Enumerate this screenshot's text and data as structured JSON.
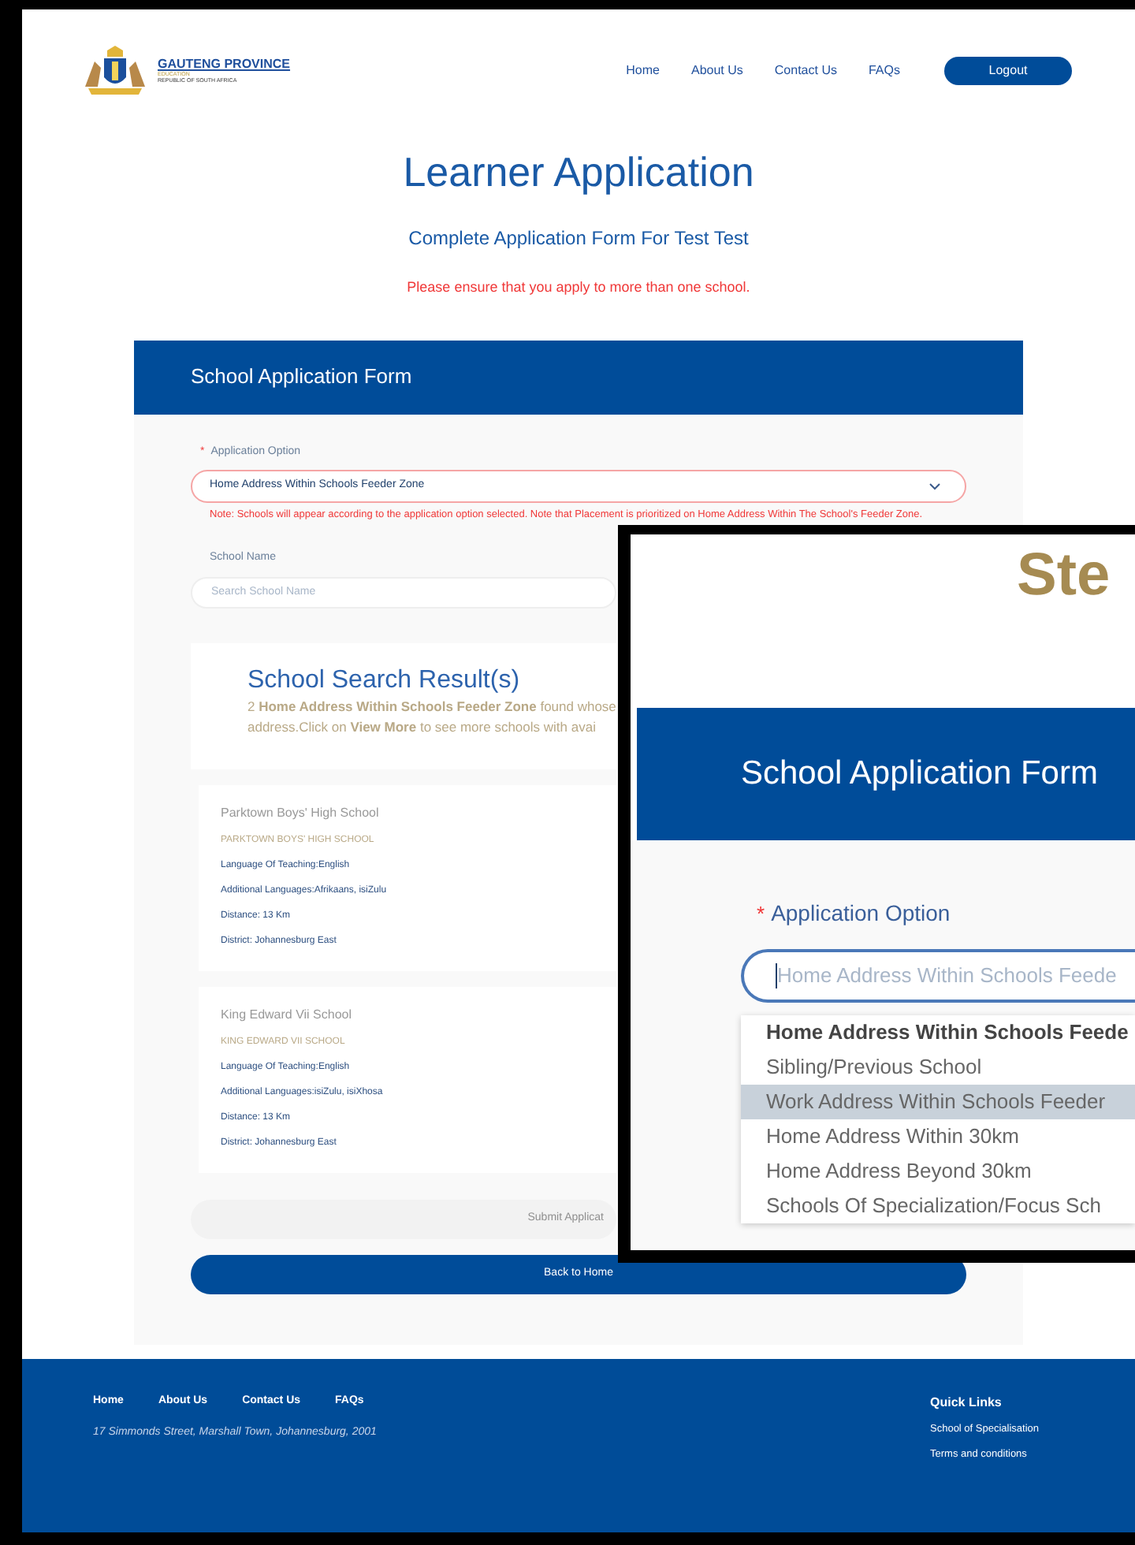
{
  "header": {
    "logo": {
      "title": "GAUTENG PROVINCE",
      "subtitle": "EDUCATION",
      "country": "REPUBLIC OF SOUTH AFRICA"
    },
    "nav": [
      "Home",
      "About Us",
      "Contact Us",
      "FAQs"
    ],
    "logout": "Logout"
  },
  "page": {
    "title": "Learner Application",
    "subtitle": "Complete Application Form For Test Test",
    "warning": "Please ensure that you apply to more than one school."
  },
  "form": {
    "title": "School Application Form",
    "required_mark": "*",
    "option_label": "Application Option",
    "option_value": "Home Address Within Schools Feeder Zone",
    "note": "Note: Schools will appear according to the application option selected. Note that Placement is prioritized on Home Address Within The School's Feeder Zone.",
    "school_label": "School Name",
    "school_placeholder": "Search School Name"
  },
  "results": {
    "title": "School Search Result(s)",
    "summary": "2 **Home Address Within Schools Feeder Zone** found whose address.Click on **View More** to see more schools with avai"
  },
  "schools": [
    {
      "name": "Parktown Boys' High School",
      "official_name": "PARKTOWN BOYS' HIGH SCHOOL",
      "language": "Language Of Teaching:English",
      "additional": "Additional Languages:Afrikaans, isiZulu",
      "distance": "Distance: 13 Km",
      "district": "District: Johannesburg East"
    },
    {
      "name": "King Edward Vii School",
      "official_name": "KING EDWARD VII SCHOOL",
      "language": "Language Of Teaching:English",
      "additional": "Additional Languages:isiZulu, isiXhosa",
      "distance": "Distance: 13 Km",
      "district": "District: Johannesburg East"
    }
  ],
  "buttons": [
    {
      "label": "Submit Applicat",
      "disabled": true
    },
    {
      "label": "Back to Home",
      "disabled": false
    }
  ],
  "footer": {
    "nav": [
      "Home",
      "About Us",
      "Contact Us",
      "FAQs"
    ],
    "address": "17 Simmonds Street, Marshall Town, Johannesburg, 2001",
    "quick_links_title": "Quick Links",
    "quick_links": [
      "School of Specialisation",
      "Terms and conditions"
    ]
  },
  "inset": {
    "heading": "Ste",
    "form_title": "School Application Form",
    "required_mark": "*",
    "option_label": "Application Option",
    "placeholder": "Home Address Within Schools Feede",
    "options": [
      {
        "label": "Home Address Within Schools Feede",
        "selected": true,
        "hovered": false
      },
      {
        "label": "Sibling/Previous School",
        "selected": false,
        "hovered": false
      },
      {
        "label": "Work Address Within Schools Feeder",
        "selected": false,
        "hovered": true
      },
      {
        "label": "Home Address Within 30km",
        "selected": false,
        "hovered": false
      },
      {
        "label": "Home Address Beyond 30km",
        "selected": false,
        "hovered": false
      },
      {
        "label": "Schools Of Specialization/Focus Sch",
        "selected": false,
        "hovered": false
      }
    ]
  }
}
